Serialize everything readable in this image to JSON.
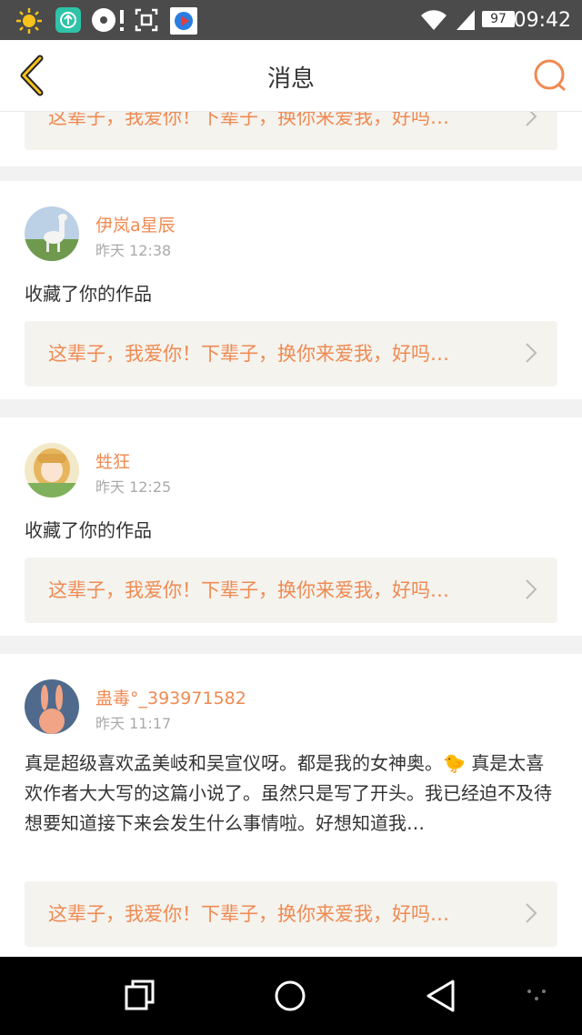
{
  "status_bar": {
    "time": "09:42",
    "battery": "97"
  },
  "header": {
    "title": "消息"
  },
  "quote_text": "这辈子，我爱你！下辈子，换你来爱我，好吗…",
  "messages": [
    {
      "user": "伊岚a星辰",
      "time": "昨天 12:38",
      "text": "收藏了你的作品"
    },
    {
      "user": "甡狂",
      "time": "昨天 12:25",
      "text": "收藏了你的作品"
    },
    {
      "user": "蛊毒°_393971582",
      "time": "昨天 11:17",
      "text": "真是超级喜欢孟美岐和吴宣仪呀。都是我的女神奥。🐤 真是太喜欢作者大大写的这篇小说了。虽然只是写了开头。我已经迫不及待想要知道接下来会发生什么事情啦。好想知道我…"
    }
  ],
  "colors": {
    "accent": "#f08a52",
    "quote_bg": "#f4f3ee",
    "status_bar": "#4b4b4b"
  }
}
